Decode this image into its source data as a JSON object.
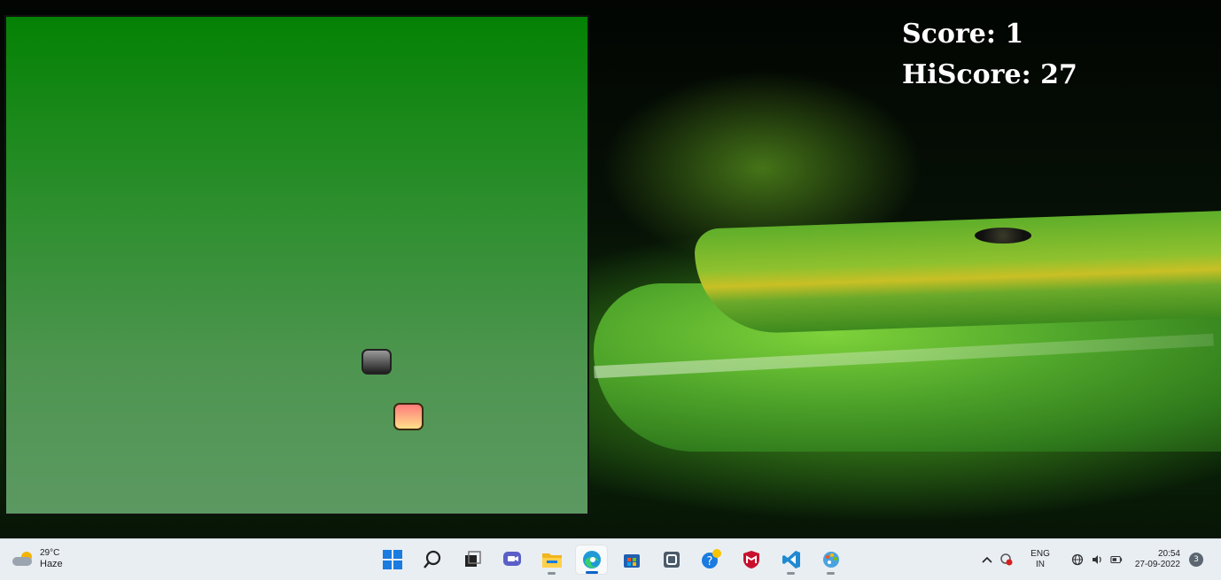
{
  "game": {
    "score_label": "Score: 1",
    "hiscore_label": "HiScore: 27",
    "score": 1,
    "hiscore": 27
  },
  "taskbar": {
    "weather": {
      "temp": "29°C",
      "condition": "Haze"
    },
    "apps": [
      "start-icon",
      "search-icon",
      "task-view-icon",
      "chat-icon",
      "file-explorer-icon",
      "edge-browser-icon",
      "store-icon",
      "app-icon",
      "help-icon",
      "mcafee-icon",
      "vscode-icon",
      "paint-icon"
    ],
    "language": {
      "code": "ENG",
      "region": "IN"
    },
    "time": "20:54",
    "date": "27-09-2022",
    "notification_count": "3"
  },
  "colors": {
    "board_top": "#048204",
    "board_bottom": "#5c9962",
    "snake": "#2a2a2a",
    "food": "#ffb07a",
    "accent": "#0a64c8"
  }
}
